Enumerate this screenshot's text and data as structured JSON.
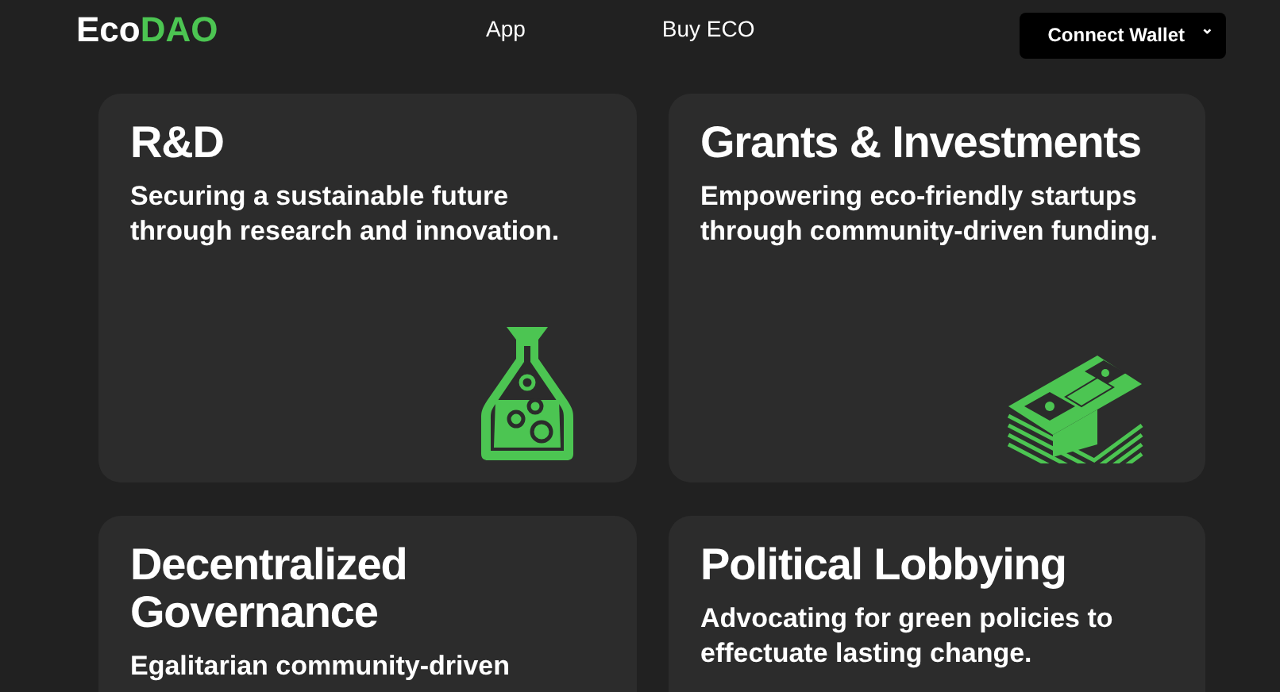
{
  "logo": {
    "first": "Eco",
    "second": "DAO"
  },
  "nav": [
    "App",
    "Buy ECO"
  ],
  "wallet_button": {
    "label": "Connect Wallet",
    "caret": "⌄"
  },
  "cards": [
    {
      "title": "R&D",
      "description": "Securing a sustainable future through research and innovation.",
      "kind": "flask"
    },
    {
      "title": "Grants & Investments",
      "description": "Empowering eco-friendly startups through community-driven funding.",
      "kind": "money"
    },
    {
      "title": "Decentralized Governance",
      "description": "Egalitarian community-driven"
    },
    {
      "title": "Political Lobbying",
      "description": "Advocating for green policies to effectuate lasting change."
    }
  ]
}
